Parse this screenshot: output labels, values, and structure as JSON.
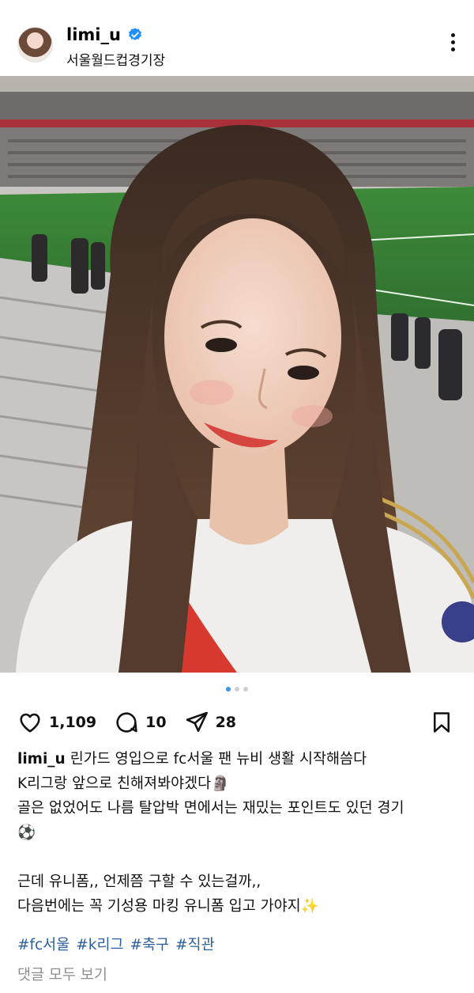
{
  "post": {
    "username": "limi_u",
    "location": "서울월드컵경기장",
    "likes": "1,109",
    "comments": "10",
    "shares": "28"
  },
  "caption": {
    "username": "limi_u",
    "line1": "린가드 영입으로 fc서울 팬 뉴비 생활 시작해씀다",
    "line2": "K리그랑 앞으로 친해져봐야겠다",
    "line2_emoji": "🗿",
    "line3": "골은 없었어도 나름 탈압박 면에서는 재밌는 포인트도 있던 경기",
    "line4_emoji": "⚽",
    "line5": "근데 유니폼,, 언제쯤 구할 수 있는걸까,,",
    "line6": "다음번에는 꼭 기성용 마킹 유니폼 입고 가야지",
    "line6_emoji": "✨"
  },
  "hashtags": [
    "#fc서울",
    "#k리그",
    "#축구",
    "#직관"
  ],
  "view_all_comments": "댓글 모두 보기",
  "carousel": {
    "current": 1,
    "total": 3
  },
  "colors": {
    "accent": "#3897f0",
    "hashtag": "#2b5f9e",
    "muted": "#8e8e8e",
    "verified": "#1e90ff"
  },
  "icons": [
    "verified-icon",
    "more-icon",
    "heart-icon",
    "comment-icon",
    "share-icon",
    "bookmark-icon"
  ]
}
